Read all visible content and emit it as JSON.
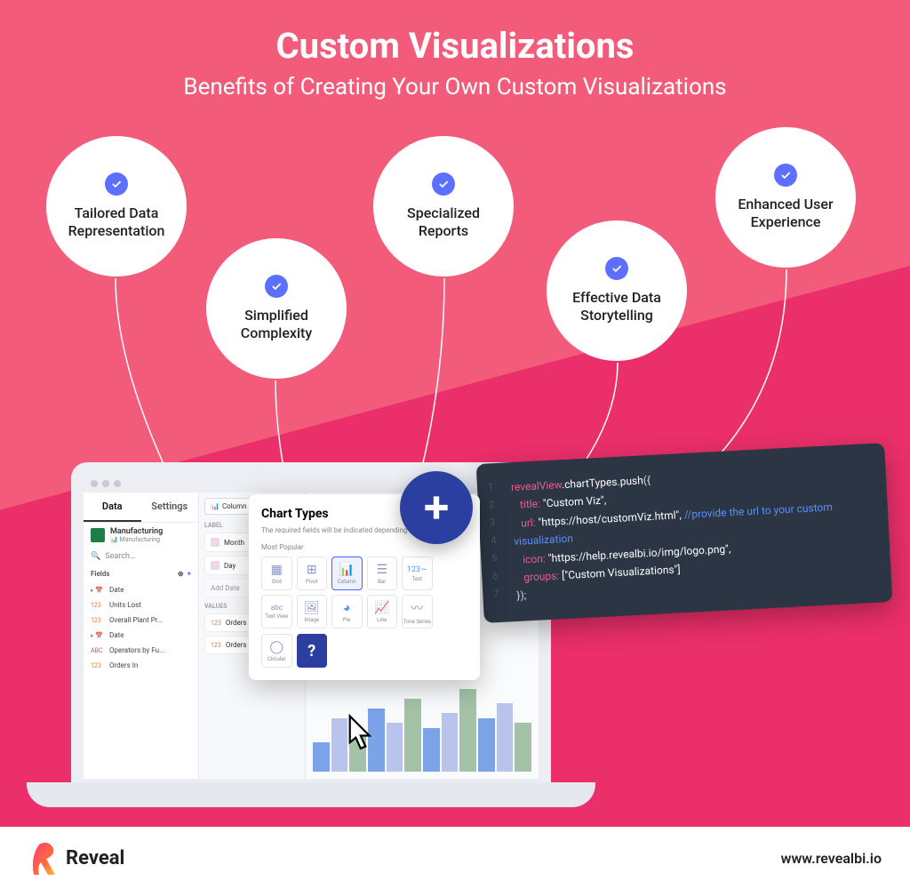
{
  "title": "Custom Visualizations",
  "subtitle": "Benefits of Creating Your Own Custom Visualizations",
  "bubbles": [
    "Tailored Data Representation",
    "Simplified Complexity",
    "Specialized Reports",
    "Effective Data Storytelling",
    "Enhanced User Experience"
  ],
  "ui": {
    "tabs": [
      "Data",
      "Settings"
    ],
    "ds_name": "Manufacturing",
    "ds_sub": "Manufacturing",
    "search": "Search...",
    "fields_label": "Fields",
    "fields": [
      {
        "type": "d",
        "name": "Date"
      },
      {
        "type": "n",
        "name": "Units Lost"
      },
      {
        "type": "n",
        "name": "Overall Plant Pr..."
      },
      {
        "type": "d",
        "name": "Date"
      },
      {
        "type": "a",
        "name": "Operators by Fu..."
      },
      {
        "type": "n",
        "name": "Orders In"
      }
    ],
    "selector": "Column",
    "label_section": "LABEL",
    "labels": [
      "Month",
      "Day",
      "Add Date"
    ],
    "values_section": "VALUES",
    "values": [
      "Orders In",
      "Orders In"
    ]
  },
  "popup": {
    "title": "Chart Types",
    "sub": "The required fields will be indicated depending on the visual...",
    "section": "Most Popular",
    "cells": [
      "Grid",
      "Pivot",
      "Column",
      "Bar",
      "Text",
      "",
      "Text View",
      "Image",
      "Pie",
      "Line",
      "Time Series",
      "",
      "Circular",
      "?"
    ]
  },
  "code": {
    "obj": "revealView",
    "prop": ".chartTypes",
    "meth": ".push",
    "title_key": "title:",
    "title_val": " \"Custom Viz\",",
    "url_key": "url:",
    "url_val": " \"https://host/customViz.html\", ",
    "url_com": "//provide the url to your custom visualization",
    "icon_key": "icon:",
    "icon_val": " \"https://help.revealbi.io/img/logo.png\",",
    "groups_key": "groups:",
    "groups_val": " [\"Custom Visualizations\"]",
    "close": "});"
  },
  "footer": {
    "brand": "Reveal",
    "url": "www.revealbi.io"
  }
}
